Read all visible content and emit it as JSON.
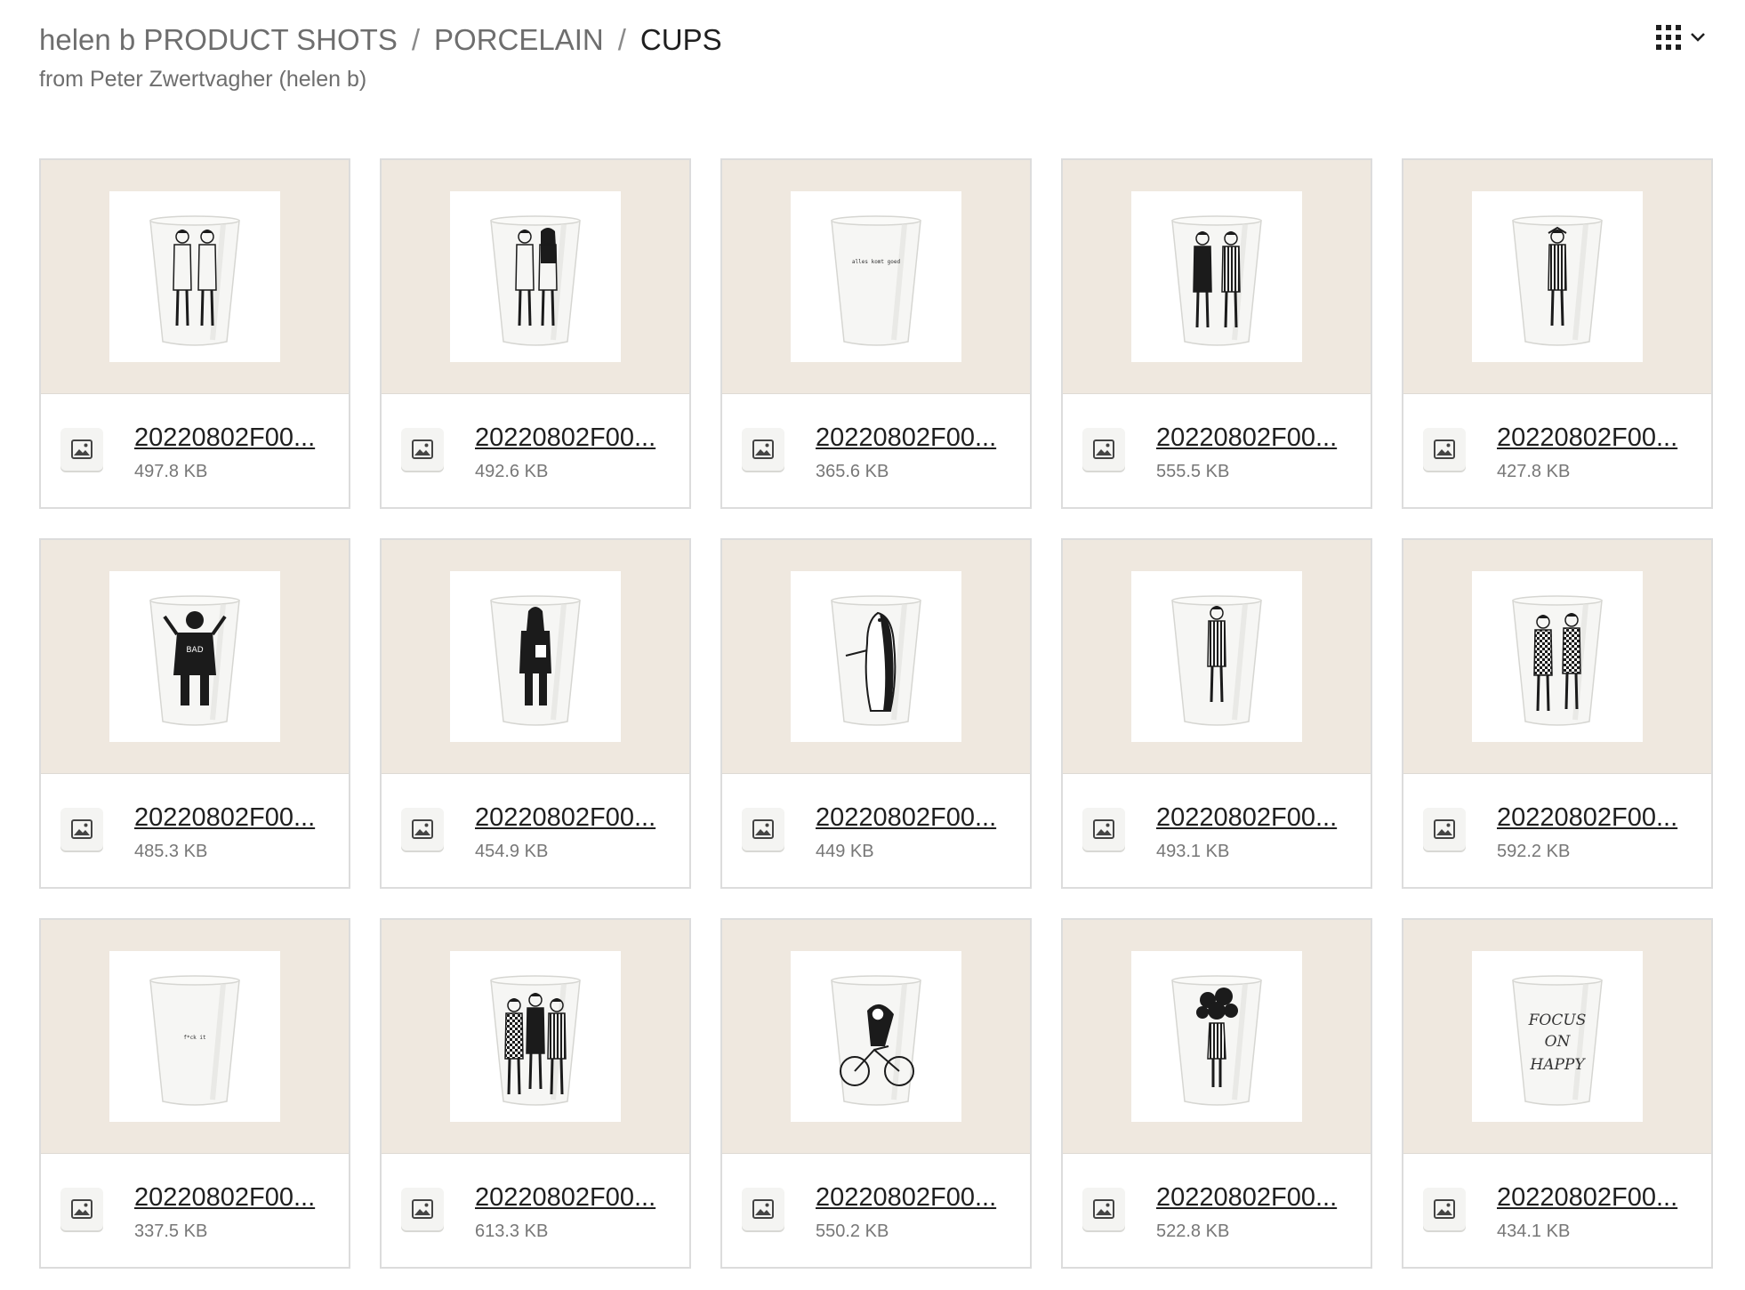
{
  "breadcrumb": {
    "root": "helen b PRODUCT SHOTS",
    "level2": "PORCELAIN",
    "current": "CUPS",
    "separator": "/"
  },
  "subtitle": "from Peter Zwertvagher (helen b)",
  "view_toggle": {
    "icon": "grid-view-icon",
    "dropdown_icon": "chevron-down-icon"
  },
  "colors": {
    "thumb_background": "#efe8df",
    "card_border": "#dcdcdc",
    "text_primary": "#1f1f1f",
    "text_secondary": "#6e6e6e"
  },
  "files": [
    {
      "name": "20220802F00...",
      "size": "497.8 KB",
      "print": "two nude figures"
    },
    {
      "name": "20220802F00...",
      "size": "492.6 KB",
      "print": "two women from behind"
    },
    {
      "name": "20220802F00...",
      "size": "365.6 KB",
      "print": "alles komt goed",
      "cup_text": "alles komt goed"
    },
    {
      "name": "20220802F00...",
      "size": "555.5 KB",
      "print": "two figures in outfits"
    },
    {
      "name": "20220802F00...",
      "size": "427.8 KB",
      "print": "swimsuit lady"
    },
    {
      "name": "20220802F00...",
      "size": "485.3 KB",
      "print": "bad ass girl"
    },
    {
      "name": "20220802F00...",
      "size": "454.9 KB",
      "print": "girl with barcode"
    },
    {
      "name": "20220802F00...",
      "size": "449 KB",
      "print": "penguin"
    },
    {
      "name": "20220802F00...",
      "size": "493.1 KB",
      "print": "striped dress"
    },
    {
      "name": "20220802F00...",
      "size": "592.2 KB",
      "print": "dancing couple"
    },
    {
      "name": "20220802F00...",
      "size": "337.5 KB",
      "print": "f*ck it",
      "cup_text": "f*ck it"
    },
    {
      "name": "20220802F00...",
      "size": "613.3 KB",
      "print": "three women"
    },
    {
      "name": "20220802F00...",
      "size": "550.2 KB",
      "print": "bicycle girl"
    },
    {
      "name": "20220802F00...",
      "size": "522.8 KB",
      "print": "flower bouquet"
    },
    {
      "name": "20220802F00...",
      "size": "434.1 KB",
      "print": "focus on happy",
      "cup_text": "FOCUS ON HAPPY"
    }
  ]
}
